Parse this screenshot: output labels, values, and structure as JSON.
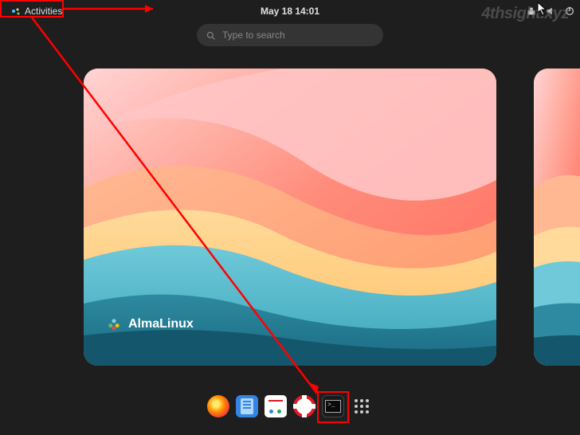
{
  "topbar": {
    "activities_label": "Activities",
    "datetime": "May 18  14:01"
  },
  "search": {
    "placeholder": "Type to search"
  },
  "wallpaper": {
    "distro_label": "AlmaLinux"
  },
  "dock": {
    "items": [
      {
        "name": "firefox-icon"
      },
      {
        "name": "text-editor-icon"
      },
      {
        "name": "software-icon"
      },
      {
        "name": "help-icon"
      },
      {
        "name": "terminal-icon"
      },
      {
        "name": "show-apps-icon"
      }
    ]
  },
  "watermark": "4thsight.xyz",
  "annotations": {
    "highlight_activities": true,
    "highlight_terminal": true,
    "arrow_from_activities_to_terminal": true
  }
}
